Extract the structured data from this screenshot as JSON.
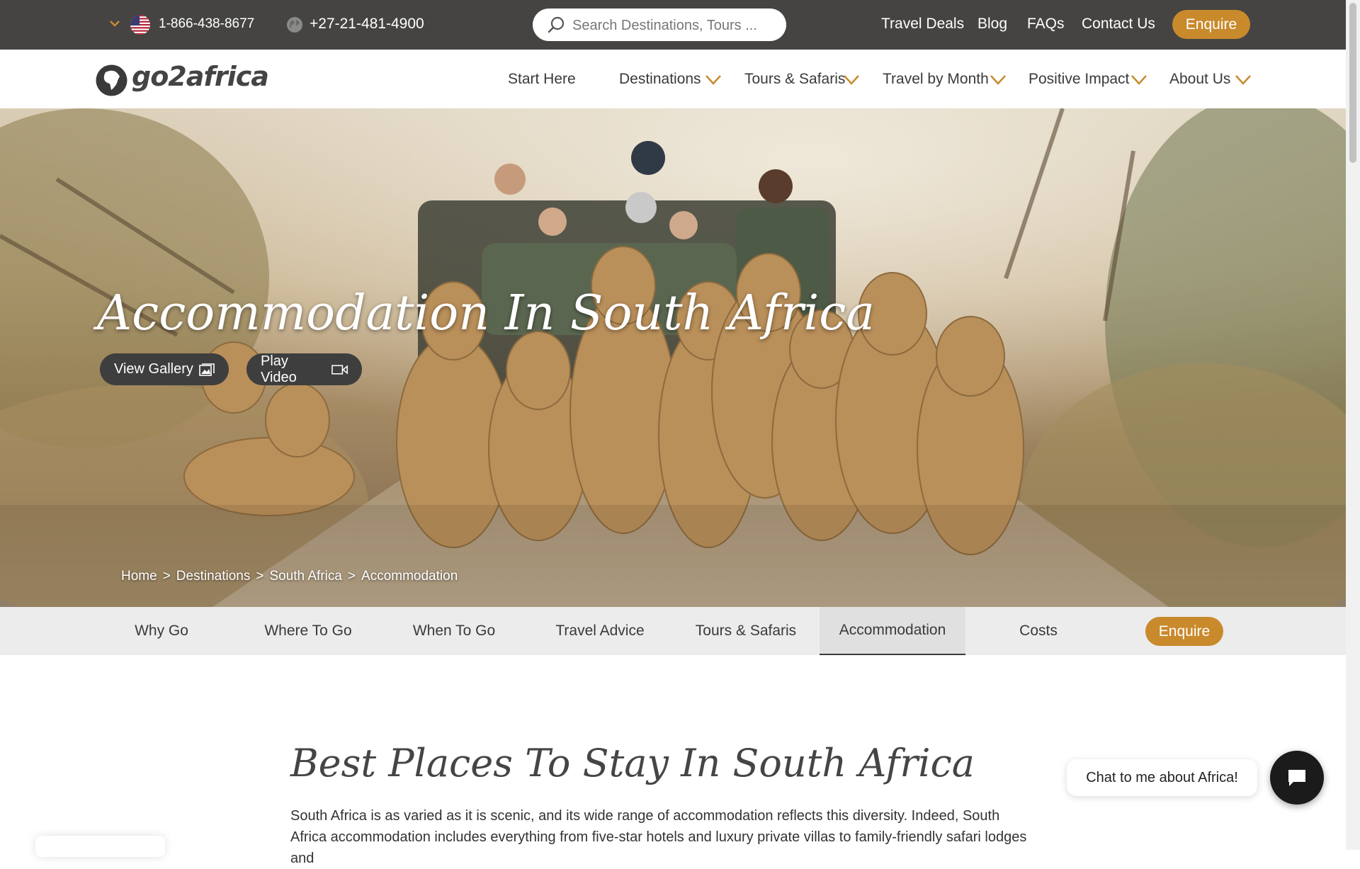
{
  "topbar": {
    "phone_us": "1-866-438-8677",
    "phone_intl": "+27-21-481-4900",
    "search_placeholder": "Search Destinations, Tours ...",
    "links": [
      "Travel Deals",
      "Blog",
      "FAQs",
      "Contact Us"
    ],
    "enquire": "Enquire"
  },
  "logo": {
    "text": "go2africa"
  },
  "nav": {
    "items": [
      "Start Here",
      "Destinations",
      "Tours & Safaris",
      "Travel by Month",
      "Positive Impact",
      "About Us"
    ]
  },
  "hero": {
    "title": "Accommodation In South Africa",
    "view_gallery": "View Gallery",
    "play_video": "Play Video",
    "breadcrumb": [
      "Home",
      "Destinations",
      "South Africa",
      "Accommodation"
    ],
    "breadcrumb_sep": ">"
  },
  "subnav": {
    "tabs": [
      "Why Go",
      "Where To Go",
      "When To Go",
      "Travel Advice",
      "Tours & Safaris",
      "Accommodation",
      "Costs"
    ],
    "active": "Accommodation",
    "enquire": "Enquire"
  },
  "content": {
    "title": "Best Places To Stay In South Africa",
    "body": "South Africa is as varied as it is scenic, and its wide range of accommodation reflects this diversity. Indeed, South Africa accommodation includes everything from five-star hotels and luxury private villas to family-friendly safari lodges and"
  },
  "chat": {
    "prompt": "Chat to me about Africa!"
  },
  "colors": {
    "accent": "#c98a2c",
    "topbar": "#454442",
    "subnav": "#ececec"
  }
}
